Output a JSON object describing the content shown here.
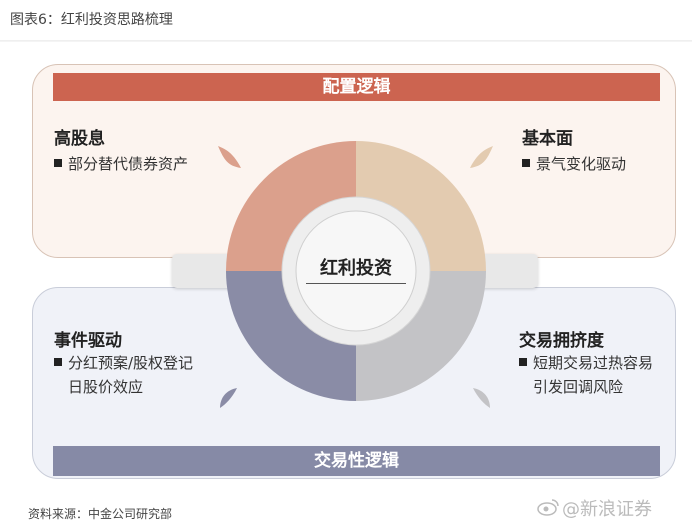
{
  "figure_title": "图表6：红利投资思路梳理",
  "top_section": {
    "header": "配置逻辑"
  },
  "bottom_section": {
    "header": "交易性逻辑"
  },
  "center": {
    "label": "红利投资"
  },
  "quadrants": {
    "top_left": {
      "title": "高股息",
      "bullet_line1": "部分替代债券资产",
      "color": "#dba08c"
    },
    "top_right": {
      "title": "基本面",
      "bullet_line1": "景气变化驱动",
      "color": "#e3cbb0"
    },
    "bottom_left": {
      "title": "事件驱动",
      "bullet_line1": "分红预案/股权登记",
      "bullet_line2": "日股价效应",
      "color": "#8a8ca6"
    },
    "bottom_right": {
      "title": "交易拥挤度",
      "bullet_line1": "短期交易过热容易",
      "bullet_line2": "引发回调风险",
      "color": "#c3c3c6"
    }
  },
  "footer": {
    "source": "资料来源：中金公司研究部",
    "watermark": "@新浪证券"
  }
}
